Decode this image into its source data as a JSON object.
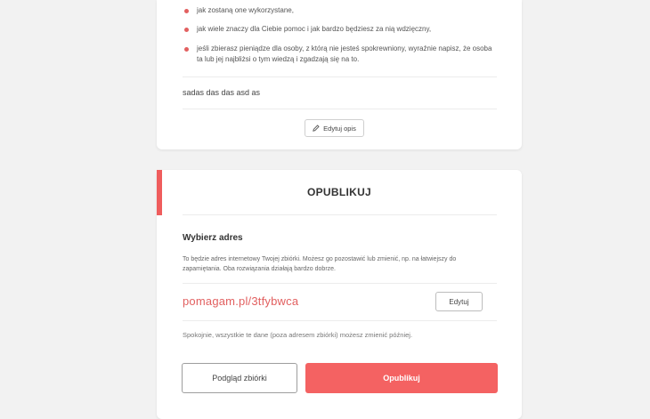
{
  "description": {
    "bullets": [
      "jak zostaną one wykorzystane,",
      "jak wiele znaczy dla Ciebie pomoc i jak bardzo będziesz za nią wdzięczny,",
      "jeśli zbierasz pieniądze dla osoby, z którą nie jesteś spokrewniony, wyraźnie napisz, że osoba ta lub jej najbliżsi o tym wiedzą i zgadzają się na to."
    ],
    "text": "sadas das das  asd as",
    "edit_button": "Edytuj opis"
  },
  "publish": {
    "title": "OPUBLIKUJ",
    "section_title": "Wybierz adres",
    "info": "To będzie adres internetowy Twojej zbiórki. Możesz go pozostawić lub zmienić, np. na łatwiejszy do zapamiętania. Oba rozwiązania działają bardzo dobrze.",
    "url": "pomagam.pl/3tfybwca",
    "edit_button": "Edytuj",
    "note": "Spokojnie, wszystkie te dane (poza adresem zbiórki) możesz zmienić później.",
    "preview_button": "Podgląd zbiórki",
    "publish_button": "Opublikuj"
  },
  "colors": {
    "accent": "#f46262",
    "background": "#f2f2f2"
  },
  "icons": {
    "edit": "pencil-icon",
    "bullet": "bullet-dot"
  }
}
